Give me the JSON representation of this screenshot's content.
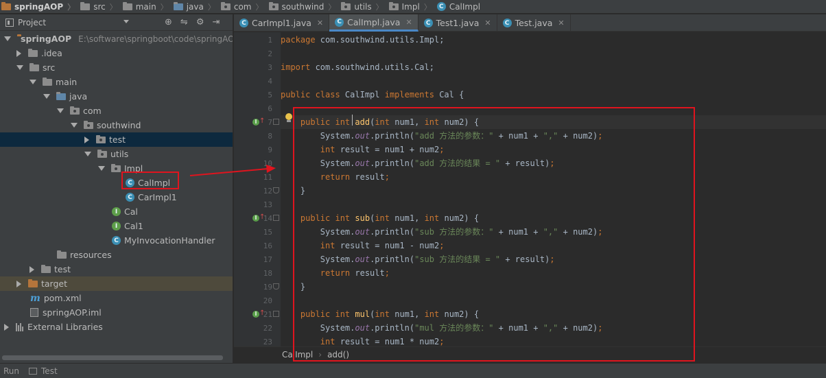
{
  "breadcrumb": [
    {
      "label": "springAOP",
      "icon": "project-folder-icon",
      "bold": true
    },
    {
      "label": "src",
      "icon": "folder-icon"
    },
    {
      "label": "main",
      "icon": "folder-icon"
    },
    {
      "label": "java",
      "icon": "folder-icon"
    },
    {
      "label": "com",
      "icon": "package-icon"
    },
    {
      "label": "southwind",
      "icon": "package-icon"
    },
    {
      "label": "utils",
      "icon": "package-icon"
    },
    {
      "label": "Impl",
      "icon": "package-icon"
    },
    {
      "label": "CalImpl",
      "icon": "class-icon"
    }
  ],
  "project_panel": {
    "title": "Project",
    "root": {
      "label": "springAOP",
      "path": "E:\\software\\springboot\\code\\springAOP"
    },
    "items": {
      "idea": ".idea",
      "src": "src",
      "main": "main",
      "java": "java",
      "com": "com",
      "southwind": "southwind",
      "test_pkg": "test",
      "utils": "utils",
      "impl": "Impl",
      "calimpl": "CalImpl",
      "carimpl1": "CarImpl1",
      "cal": "Cal",
      "cal1": "Cal1",
      "handler": "MyInvocationHandler",
      "resources": "resources",
      "test_dir": "test",
      "target": "target",
      "pom": "pom.xml",
      "iml": "springAOP.iml",
      "libs": "External Libraries"
    }
  },
  "tabs": [
    {
      "label": "CarImpl1.java",
      "active": false
    },
    {
      "label": "CalImpl.java",
      "active": true
    },
    {
      "label": "Test1.java",
      "active": false
    },
    {
      "label": "Test.java",
      "active": false
    }
  ],
  "code_lines": [
    {
      "n": "1",
      "html": "<span class='kw'>package</span> com.southwind.utils.Impl;"
    },
    {
      "n": "2",
      "html": ""
    },
    {
      "n": "3",
      "html": "<span class='kw'>import</span> com.southwind.utils.Cal;"
    },
    {
      "n": "4",
      "html": ""
    },
    {
      "n": "5",
      "html": "<span class='kw'>public class</span> CalImpl <span class='kw'>implements</span> Cal {"
    },
    {
      "n": "6",
      "html": ""
    },
    {
      "n": "7",
      "html": "    <span class='kw'>public int</span> <span class='fn'>add</span>(<span class='kw'>int</span> num1, <span class='kw'>int</span> num2) {"
    },
    {
      "n": "8",
      "html": "        System.<span class='field'>out</span>.println(<span class='str'>\"add 方法的参数：\"</span> + num1 + <span class='str'>\",\"</span> + num2)<span class='kw'>;</span>"
    },
    {
      "n": "9",
      "html": "        <span class='kw'>int</span> result = num1 + num2<span class='kw'>;</span>"
    },
    {
      "n": "10",
      "html": "        System.<span class='field'>out</span>.println(<span class='str'>\"add 方法的结果 = \"</span> + result)<span class='kw'>;</span>"
    },
    {
      "n": "11",
      "html": "        <span class='kw'>return</span> result<span class='kw'>;</span>"
    },
    {
      "n": "12",
      "html": "    }"
    },
    {
      "n": "13",
      "html": ""
    },
    {
      "n": "14",
      "html": "    <span class='kw'>public int</span> <span class='fn'>sub</span>(<span class='kw'>int</span> num1, <span class='kw'>int</span> num2) {"
    },
    {
      "n": "15",
      "html": "        System.<span class='field'>out</span>.println(<span class='str'>\"sub 方法的参数：\"</span> + num1 + <span class='str'>\",\"</span> + num2)<span class='kw'>;</span>"
    },
    {
      "n": "16",
      "html": "        <span class='kw'>int</span> result = num1 - num2<span class='kw'>;</span>"
    },
    {
      "n": "17",
      "html": "        System.<span class='field'>out</span>.println(<span class='str'>\"sub 方法的结果 = \"</span> + result)<span class='kw'>;</span>"
    },
    {
      "n": "18",
      "html": "        <span class='kw'>return</span> result<span class='kw'>;</span>"
    },
    {
      "n": "19",
      "html": "    }"
    },
    {
      "n": "20",
      "html": ""
    },
    {
      "n": "21",
      "html": "    <span class='kw'>public int</span> <span class='fn'>mul</span>(<span class='kw'>int</span> num1, <span class='kw'>int</span> num2) {"
    },
    {
      "n": "22",
      "html": "        System.<span class='field'>out</span>.println(<span class='str'>\"mul 方法的参数：\"</span> + num1 + <span class='str'>\",\"</span> + num2)<span class='kw'>;</span>"
    },
    {
      "n": "23",
      "html": "        <span class='kw'>int</span> result = num1 * num2<span class='kw'>;</span>"
    }
  ],
  "editor_footer": {
    "class_name": "CalImpl",
    "method": "add()"
  },
  "statusbar": {
    "run": "Run",
    "test": "Test"
  },
  "colors": {
    "annotation": "#e0141e",
    "keyword": "#cc7832",
    "string": "#6a8759",
    "method": "#ffc66d"
  }
}
